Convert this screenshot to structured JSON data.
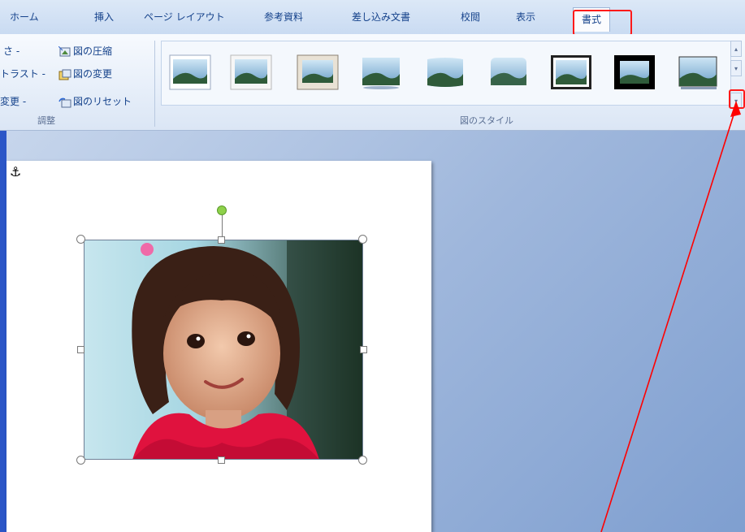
{
  "tabs": [
    "ホーム",
    "挿入",
    "ページ レイアウト",
    "参考資料",
    "差し込み文書",
    "校閲",
    "表示",
    "書式"
  ],
  "active_tab": "書式",
  "adjust_group": {
    "label": "調整",
    "left_items": [
      "さ -",
      "トラスト -",
      "変更 -"
    ],
    "right_items": [
      "図の圧縮",
      "図の変更",
      "図のリセット"
    ]
  },
  "styles_group": {
    "label": "図のスタイル",
    "style_count": 9
  },
  "anchor_symbol": "⚓",
  "colors": {
    "accent_red": "#ff1a1a",
    "ribbon_text": "#15428b",
    "doc_left_bar": "#2b56c7"
  }
}
